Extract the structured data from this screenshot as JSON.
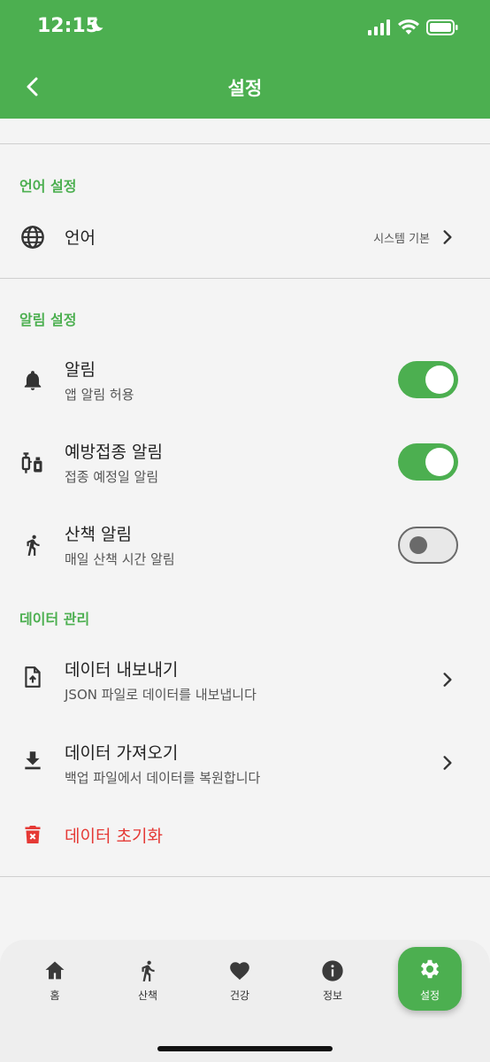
{
  "status_bar": {
    "time": "12:15"
  },
  "app_bar": {
    "title": "설정"
  },
  "sections": {
    "language": {
      "title": "언어 설정",
      "language_row": {
        "title": "언어",
        "value": "시스템 기본"
      }
    },
    "notifications": {
      "title": "알림 설정",
      "alarm": {
        "title": "알림",
        "subtitle": "앱 알림 허용",
        "enabled": true
      },
      "vaccination": {
        "title": "예방접종 알림",
        "subtitle": "접종 예정일 알림",
        "enabled": true
      },
      "walk": {
        "title": "산책 알림",
        "subtitle": "매일 산책 시간 알림",
        "enabled": false
      }
    },
    "data": {
      "title": "데이터 관리",
      "export": {
        "title": "데이터 내보내기",
        "subtitle": "JSON 파일로 데이터를 내보냅니다"
      },
      "import": {
        "title": "데이터 가져오기",
        "subtitle": "백업 파일에서 데이터를 복원합니다"
      },
      "reset": {
        "title": "데이터 초기화"
      }
    }
  },
  "bottom_nav": {
    "items": [
      {
        "label": "홈",
        "icon": "home-icon"
      },
      {
        "label": "산책",
        "icon": "walk-icon"
      },
      {
        "label": "건강",
        "icon": "heart-icon"
      },
      {
        "label": "정보",
        "icon": "info-icon"
      },
      {
        "label": "설정",
        "icon": "gear-icon",
        "active": true
      }
    ]
  },
  "colors": {
    "primary": "#4caf50",
    "danger": "#e53935"
  }
}
